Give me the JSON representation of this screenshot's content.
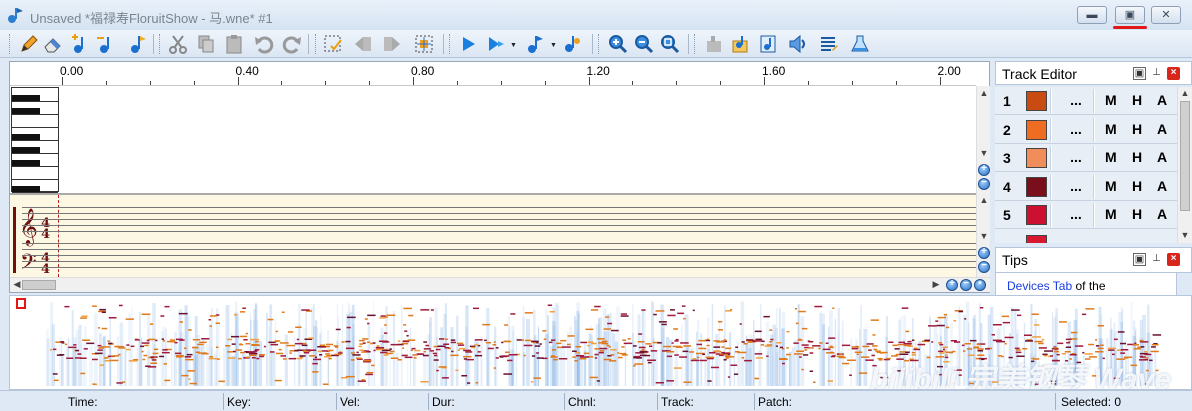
{
  "window": {
    "title": "Unsaved *福禄寿FloruitShow - 马.wne* #1",
    "app_icon": "music-note-app-icon",
    "controls": [
      "minimize-icon",
      "restore-icon",
      "close-icon"
    ]
  },
  "toolbar": {
    "groups": [
      [
        "pencil-icon",
        "eraser-icon",
        "note-add-icon",
        "note-remove-icon",
        "note-icon"
      ],
      [
        "cut-icon",
        "copy-icon",
        "paste-icon",
        "undo-icon",
        "redo-icon"
      ],
      [
        "select-icon",
        "move-left-icon",
        "move-right-icon",
        "snap-icon"
      ],
      [
        "play-icon",
        "play-menu-icon",
        "note-menu-icon",
        "tempo-icon"
      ],
      [
        "zoom-in-icon",
        "zoom-out-icon",
        "zoom-fit-icon"
      ],
      [
        "instrument-icon",
        "score-icon",
        "notebook-icon",
        "speaker-icon",
        "list-icon",
        "flask-icon"
      ]
    ]
  },
  "ruler": {
    "labels": [
      "0.00",
      "0.40",
      "0.80",
      "1.20",
      "1.60",
      "2.00"
    ]
  },
  "track_editor": {
    "title": "Track Editor",
    "more_label": "...",
    "flags": [
      "M",
      "H",
      "A"
    ],
    "tracks": [
      {
        "num": "1",
        "color": "#c84b12"
      },
      {
        "num": "2",
        "color": "#ef6d22"
      },
      {
        "num": "3",
        "color": "#f08d5a"
      },
      {
        "num": "4",
        "color": "#7a0f1c"
      },
      {
        "num": "5",
        "color": "#cc1030"
      }
    ]
  },
  "tips": {
    "title": "Tips",
    "link": "Devices Tab",
    "text": " of the"
  },
  "watermark": "bilibili 完美钢琴 Wave",
  "status": {
    "time": "Time:",
    "key": "Key:",
    "vel": "Vel:",
    "dur": "Dur:",
    "chnl": "Chnl:",
    "track": "Track:",
    "patch": "Patch:",
    "selected": "Selected: 0"
  }
}
